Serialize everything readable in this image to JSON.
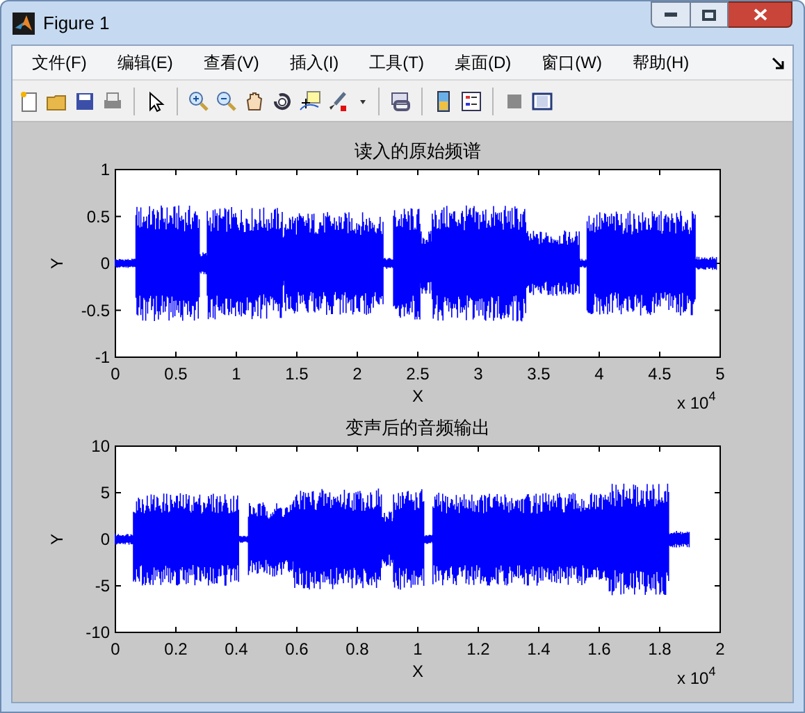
{
  "window": {
    "title": "Figure 1"
  },
  "menu": [
    "文件(F)",
    "编辑(E)",
    "查看(V)",
    "插入(I)",
    "工具(T)",
    "桌面(D)",
    "窗口(W)",
    "帮助(H)"
  ],
  "axes": [
    {
      "title": "读入的原始频谱",
      "xlabel": "X",
      "ylabel": "Y",
      "xticks": [
        "0",
        "0.5",
        "1",
        "1.5",
        "2",
        "2.5",
        "3",
        "3.5",
        "4",
        "4.5",
        "5"
      ],
      "yticks": [
        "1",
        "0.5",
        "0",
        "-0.5",
        "-1"
      ],
      "exponent_base": "x 10",
      "exponent_power": "4"
    },
    {
      "title": "变声后的音频输出",
      "xlabel": "X",
      "ylabel": "Y",
      "xticks": [
        "0",
        "0.2",
        "0.4",
        "0.6",
        "0.8",
        "1",
        "1.2",
        "1.4",
        "1.6",
        "1.8",
        "2"
      ],
      "yticks": [
        "10",
        "5",
        "0",
        "-5",
        "-10"
      ],
      "exponent_base": "x 10",
      "exponent_power": "4"
    }
  ]
}
